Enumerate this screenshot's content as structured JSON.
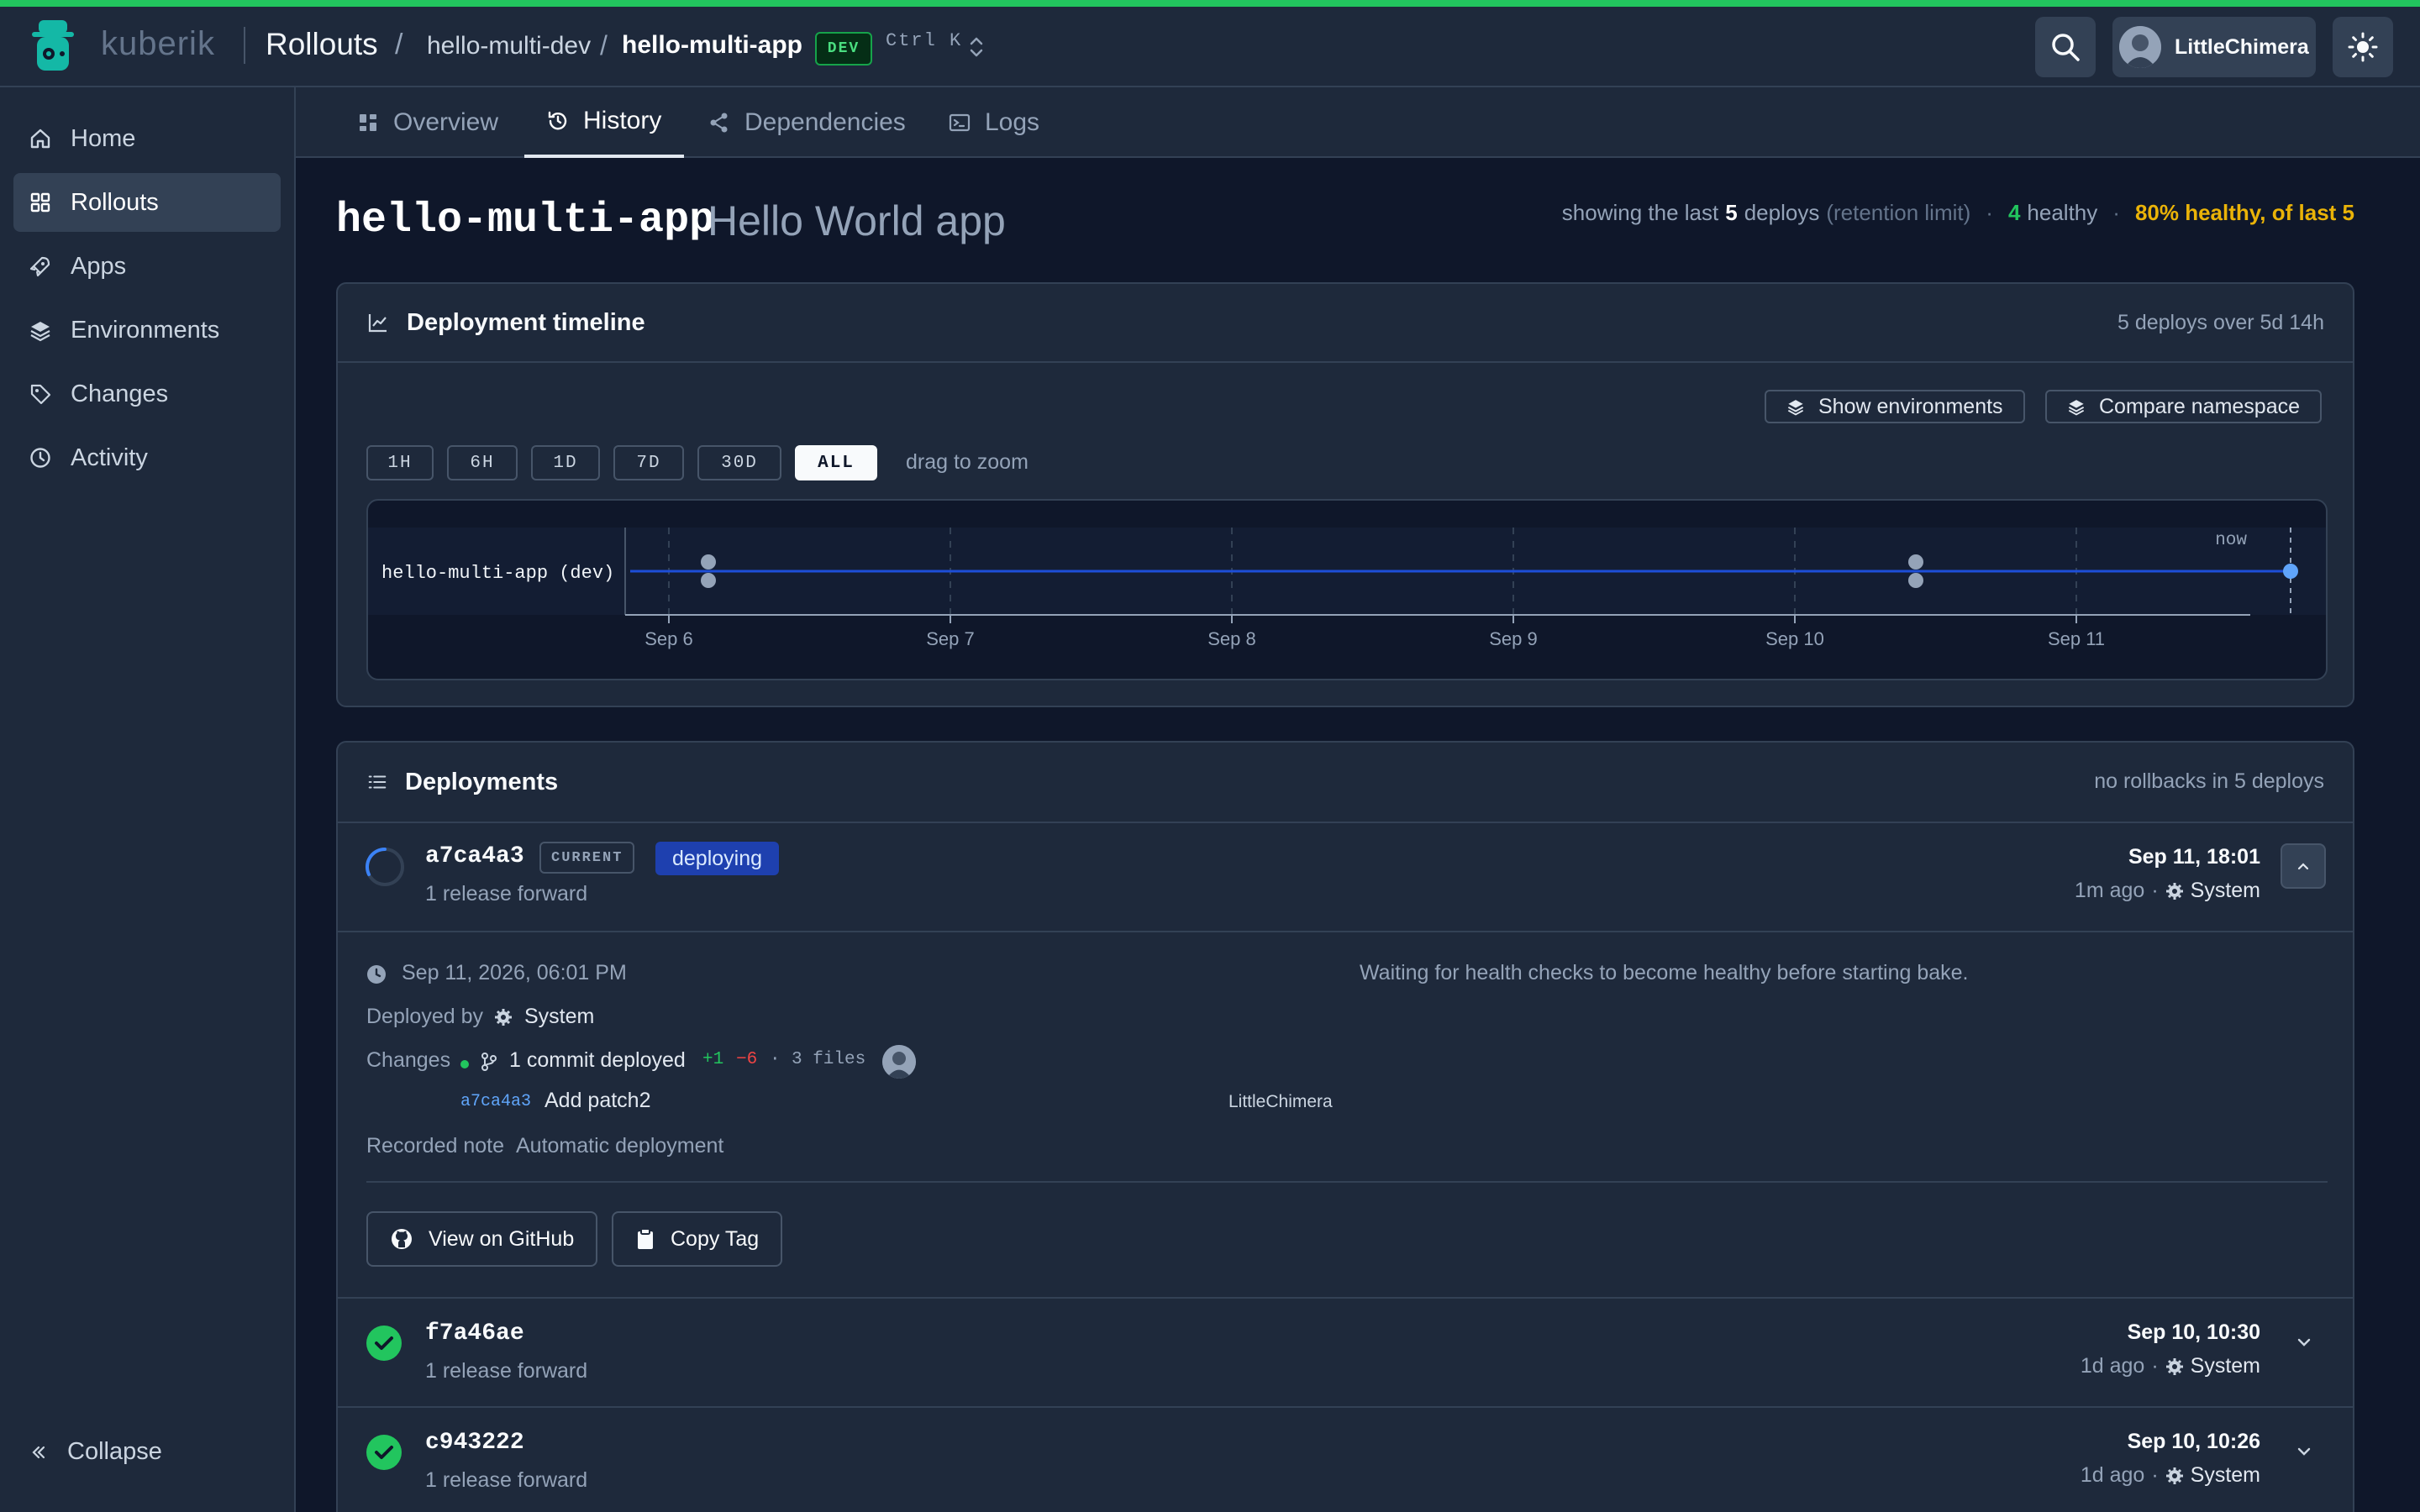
{
  "app": {
    "brand": "kuberik",
    "section": "Rollouts",
    "namespace": "hello-multi-dev",
    "rollout": "hello-multi-app",
    "env_badge": "DEV",
    "shortcut": "Ctrl K",
    "user": "LittleChimera",
    "accent_color": "#22c55e"
  },
  "sidebar": {
    "items": [
      {
        "label": "Home",
        "icon": "home-icon"
      },
      {
        "label": "Rollouts",
        "icon": "grid-icon",
        "active": true
      },
      {
        "label": "Apps",
        "icon": "rocket-icon"
      },
      {
        "label": "Environments",
        "icon": "layers-icon"
      },
      {
        "label": "Changes",
        "icon": "tag-icon"
      },
      {
        "label": "Activity",
        "icon": "clock-icon"
      }
    ],
    "collapse_label": "Collapse"
  },
  "tabs": [
    {
      "label": "Overview",
      "icon": "grid-icon"
    },
    {
      "label": "History",
      "icon": "history-icon",
      "active": true
    },
    {
      "label": "Dependencies",
      "icon": "share-icon"
    },
    {
      "label": "Logs",
      "icon": "terminal-icon"
    }
  ],
  "page": {
    "title": "hello-multi-app",
    "subtitle": "Hello World app",
    "summary": {
      "prefix": "showing the last",
      "count": "5",
      "deploys": "deploys",
      "retention": "(retention limit)",
      "dot": "·",
      "healthy_count": "4",
      "healthy_label": "healthy",
      "health_pct": "80% healthy, of last 5"
    }
  },
  "timeline": {
    "title": "Deployment timeline",
    "meta": "5 deploys over 5d 14h",
    "show_env_label": "Show environments",
    "compare_label": "Compare namespace",
    "ranges": [
      "1H",
      "6H",
      "1D",
      "7D",
      "30D",
      "ALL"
    ],
    "active_range": "ALL",
    "drag_hint": "drag to zoom",
    "track_label": "hello-multi-app (dev)",
    "now_label": "now",
    "ticks": [
      "Sep 6",
      "Sep 7",
      "Sep 8",
      "Sep 9",
      "Sep 10",
      "Sep 11"
    ]
  },
  "deployments": {
    "title": "Deployments",
    "meta": "no rollbacks in 5 deploys",
    "rows": [
      {
        "sha": "a7ca4a3",
        "current_badge": "CURRENT",
        "status_badge": "deploying",
        "release": "1 release forward",
        "time": "Sep 11, 18:01",
        "ago": "1m ago",
        "sep": "·",
        "by": "System",
        "expanded": true
      },
      {
        "sha": "f7a46ae",
        "release": "1 release forward",
        "time": "Sep 10, 10:30",
        "ago": "1d ago",
        "sep": "·",
        "by": "System"
      },
      {
        "sha": "c943222",
        "release": "1 release forward",
        "time": "Sep 10, 10:26",
        "ago": "1d ago",
        "sep": "·",
        "by": "System"
      }
    ],
    "detail": {
      "timestamp": "Sep 11, 2026, 06:01 PM",
      "message": "Waiting for health checks to become healthy before starting bake.",
      "deployed_by_label": "Deployed by",
      "deployed_by": "System",
      "changes_label": "Changes",
      "commits": "1 commit deployed",
      "additions": "+1",
      "deletions": "−6",
      "sep": "·",
      "files": "3 files",
      "commit_sha": "a7ca4a3",
      "commit_msg": "Add patch2",
      "commit_author": "LittleChimera",
      "note_label": "Recorded note",
      "note": "Automatic deployment",
      "github_label": "View on GitHub",
      "copy_label": "Copy Tag"
    }
  }
}
